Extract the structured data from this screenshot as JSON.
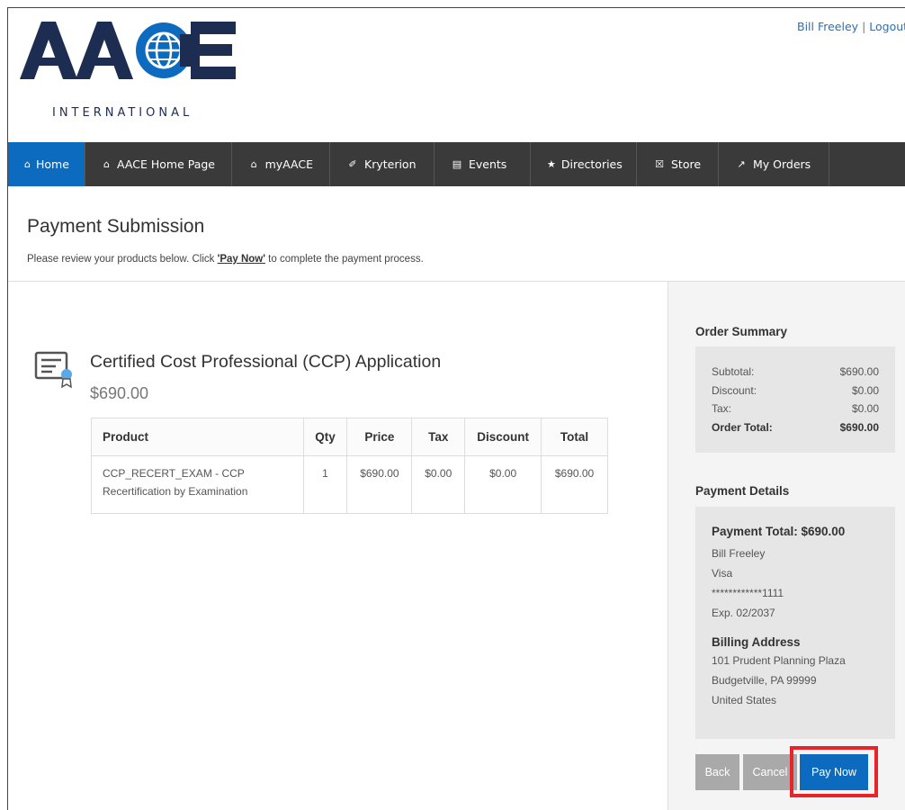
{
  "header": {
    "user_name": "Bill Freeley",
    "separator": "|",
    "logout_label": "Logout",
    "logo_text": "AACE",
    "logo_subtext": "INTERNATIONAL"
  },
  "nav": {
    "items": [
      {
        "label": "Home",
        "icon": "home-icon",
        "active": true
      },
      {
        "label": "AACE Home Page",
        "icon": "home-icon"
      },
      {
        "label": "myAACE",
        "icon": "home-icon"
      },
      {
        "label": "Kryterion",
        "icon": "edit-icon"
      },
      {
        "label": "Events",
        "icon": "calendar-icon"
      },
      {
        "label": "Directories",
        "icon": "star-icon"
      },
      {
        "label": "Store",
        "icon": "cart-icon"
      },
      {
        "label": "My Orders",
        "icon": "pin-icon"
      }
    ]
  },
  "page": {
    "title": "Payment Submission",
    "subtitle_before": "Please review your products below. Click ",
    "subtitle_link": "'Pay Now'",
    "subtitle_after": " to complete the payment process."
  },
  "product": {
    "icon": "certificate-icon",
    "name": "Certified Cost Professional (CCP) Application",
    "price": "$690.00",
    "table": {
      "headers": [
        "Product",
        "Qty",
        "Price",
        "Tax",
        "Discount",
        "Total"
      ],
      "rows": [
        {
          "product_line1": "CCP_RECERT_EXAM - CCP",
          "product_line2": "Recertification by Examination",
          "qty": "1",
          "price": "$690.00",
          "tax": "$0.00",
          "discount": "$0.00",
          "total": "$690.00"
        }
      ]
    }
  },
  "order_summary": {
    "title": "Order Summary",
    "rows": [
      {
        "label": "Subtotal:",
        "value": "$690.00"
      },
      {
        "label": "Discount:",
        "value": "$0.00"
      },
      {
        "label": "Tax:",
        "value": "$0.00"
      },
      {
        "label": "Order Total:",
        "value": "$690.00"
      }
    ]
  },
  "payment_details": {
    "title": "Payment Details",
    "payment_total": "Payment Total: $690.00",
    "name": "Bill Freeley",
    "card_type": "Visa",
    "card_number": "************1111",
    "expiry": "Exp. 02/2037",
    "billing_title": "Billing Address",
    "address_line1": "101 Prudent Planning Plaza",
    "address_line2": "Budgetville, PA 99999",
    "address_line3": "United States"
  },
  "buttons": {
    "back": "Back",
    "cancel": "Cancel",
    "pay_now": "Pay Now"
  },
  "colors": {
    "brand_blue": "#0d6bbf",
    "logo_navy": "#1d2d52",
    "highlight_red": "#e8232a"
  }
}
